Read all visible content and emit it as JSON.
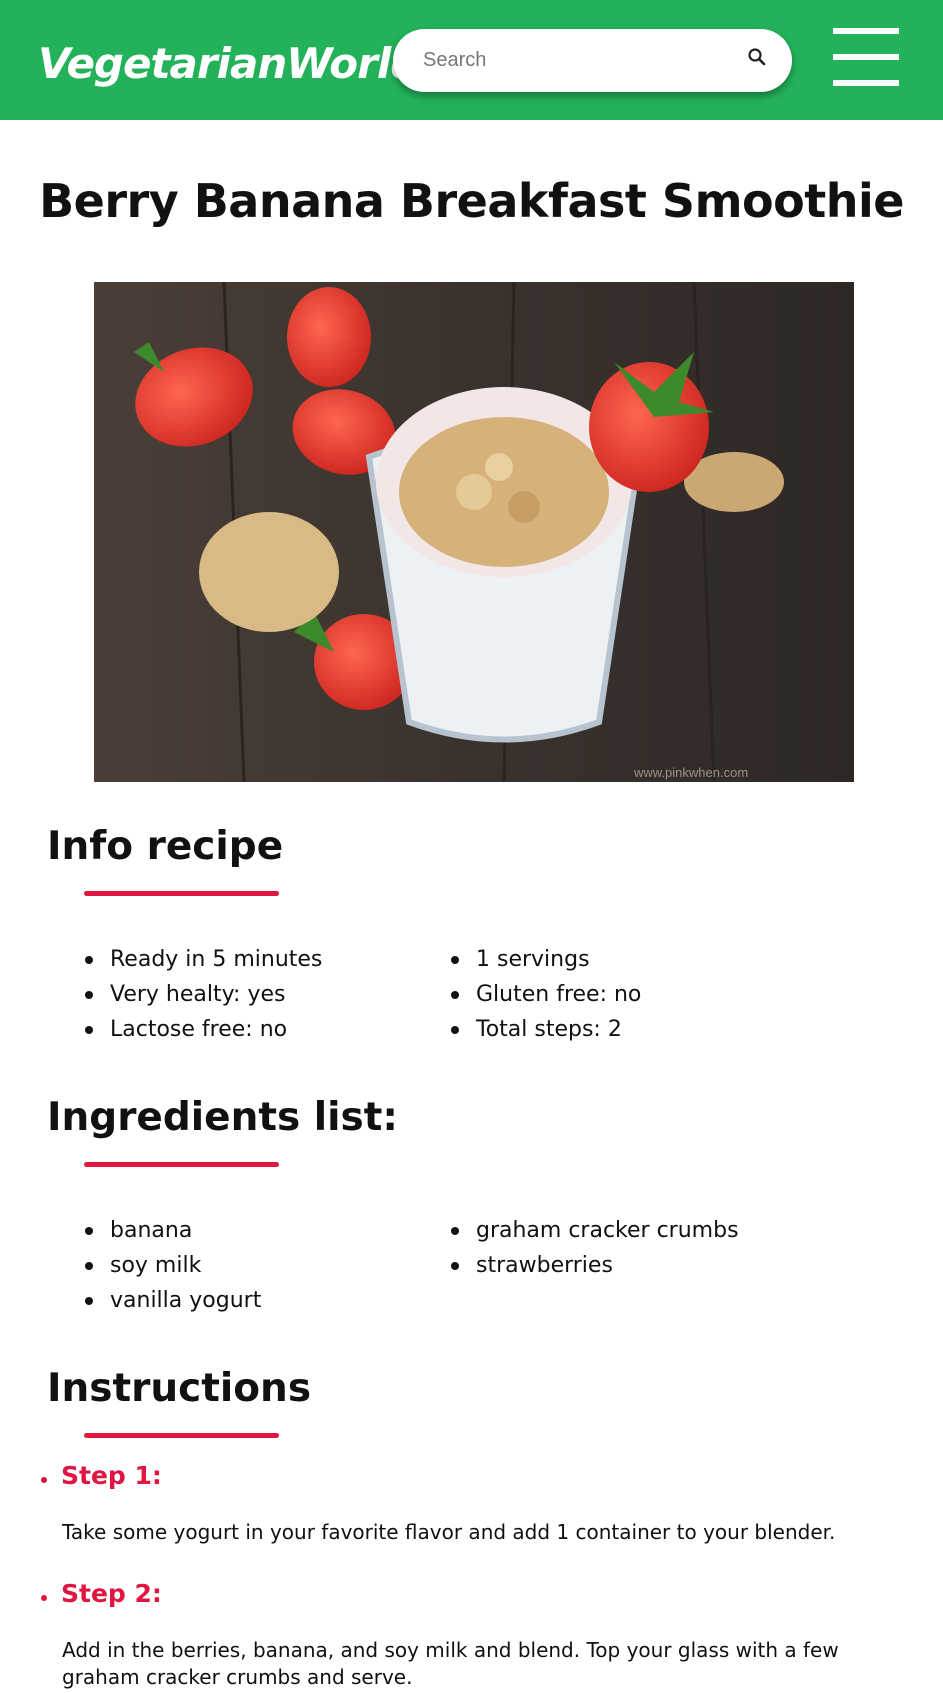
{
  "header": {
    "logo": "VegetarianWorld",
    "search_placeholder": "Search",
    "colors": {
      "bar": "#23b25a",
      "text": "#ffffff"
    }
  },
  "recipe": {
    "title": "Berry Banana Breakfast Smoothie",
    "image_watermark": "www.pinkwhen.com"
  },
  "info": {
    "heading": "Info recipe",
    "left": [
      "Ready in 5 minutes",
      "Very healty: yes",
      "Lactose free: no"
    ],
    "right": [
      "1 servings",
      "Gluten free: no",
      "Total steps: 2"
    ]
  },
  "ingredients": {
    "heading": "Ingredients list:",
    "left": [
      "banana",
      "soy milk",
      "vanilla yogurt"
    ],
    "right": [
      "graham cracker crumbs",
      "strawberries"
    ]
  },
  "instructions": {
    "heading": "Instructions",
    "steps": [
      {
        "label": "Step 1:",
        "text": "Take some yogurt in your favorite flavor and add 1 container to your blender."
      },
      {
        "label": "Step 2:",
        "text": "Add in the berries, banana, and soy milk and blend. Top your glass with a few graham cracker crumbs and serve."
      }
    ]
  },
  "accent_color": "#e01540"
}
